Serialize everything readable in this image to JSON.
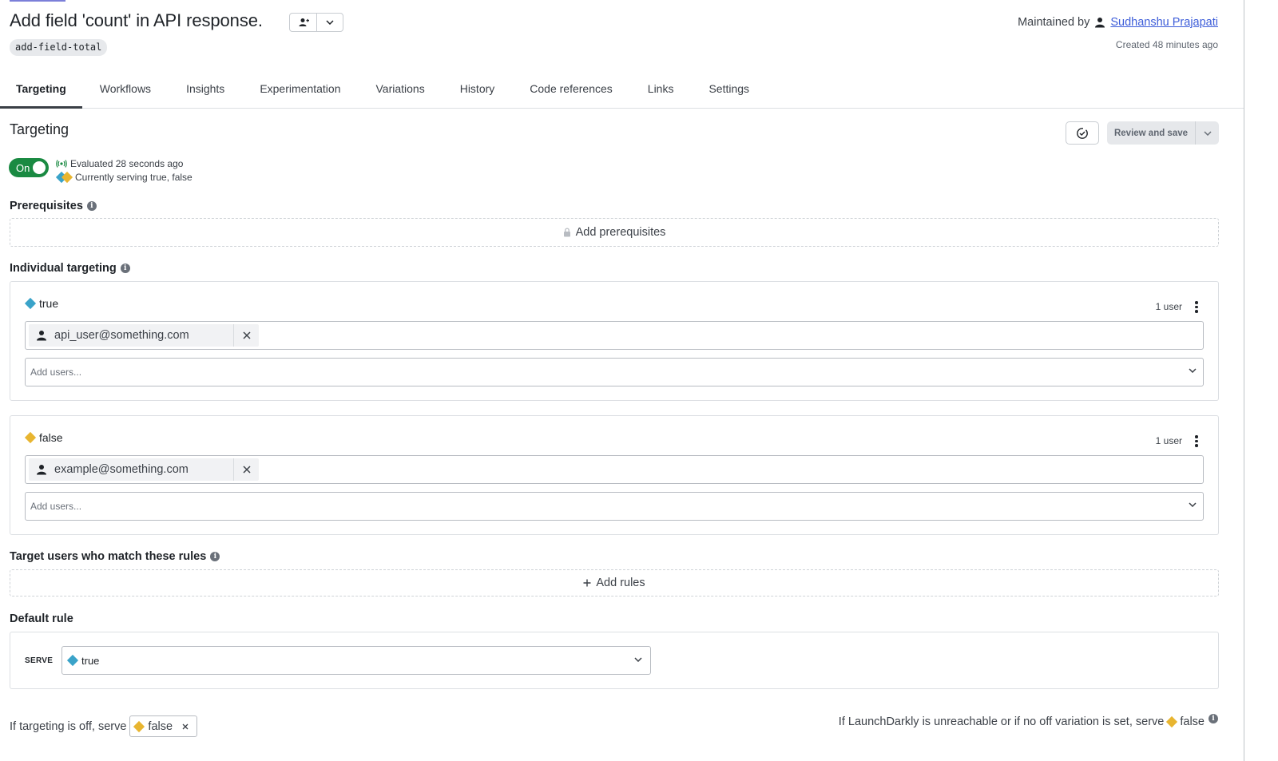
{
  "header": {
    "flag_name": "Add field 'count' in API response.",
    "flag_key": "add-field-total",
    "maintained_by_label": "Maintained by",
    "maintainer_name": "Sudhanshu Prajapati",
    "created_text": "Created 48 minutes ago"
  },
  "tabs": [
    {
      "label": "Targeting",
      "active": true
    },
    {
      "label": "Workflows"
    },
    {
      "label": "Insights"
    },
    {
      "label": "Experimentation"
    },
    {
      "label": "Variations"
    },
    {
      "label": "History"
    },
    {
      "label": "Code references"
    },
    {
      "label": "Links"
    },
    {
      "label": "Settings"
    }
  ],
  "targeting": {
    "title": "Targeting",
    "review_button": "Review and save",
    "toggle_label": "On",
    "evaluated_text": "Evaluated 28 seconds ago",
    "serving_text": "Currently serving true, false"
  },
  "prerequisites": {
    "title": "Prerequisites",
    "add_label": "Add prerequisites"
  },
  "individual": {
    "title": "Individual targeting",
    "variations": [
      {
        "name": "true",
        "count": "1 user",
        "user": "api_user@something.com",
        "placeholder": "Add users...",
        "color": "#3aa3c9"
      },
      {
        "name": "false",
        "count": "1 user",
        "user": "example@something.com",
        "placeholder": "Add users...",
        "color": "#e8b530"
      }
    ]
  },
  "rules": {
    "title": "Target users who match these rules",
    "add_label": "Add rules"
  },
  "default_rule": {
    "title": "Default rule",
    "serve_label": "SERVE",
    "serve_value": "true"
  },
  "footer": {
    "off_text": "If targeting is off, serve",
    "off_value": "false",
    "fallback_text": "If LaunchDarkly is unreachable or if no off variation is set, serve",
    "fallback_value": "false"
  },
  "colors": {
    "toggle_on": "#1a8a42",
    "link": "#3d5dd9",
    "true_variation": "#3aa3c9",
    "false_variation": "#e8b530"
  }
}
